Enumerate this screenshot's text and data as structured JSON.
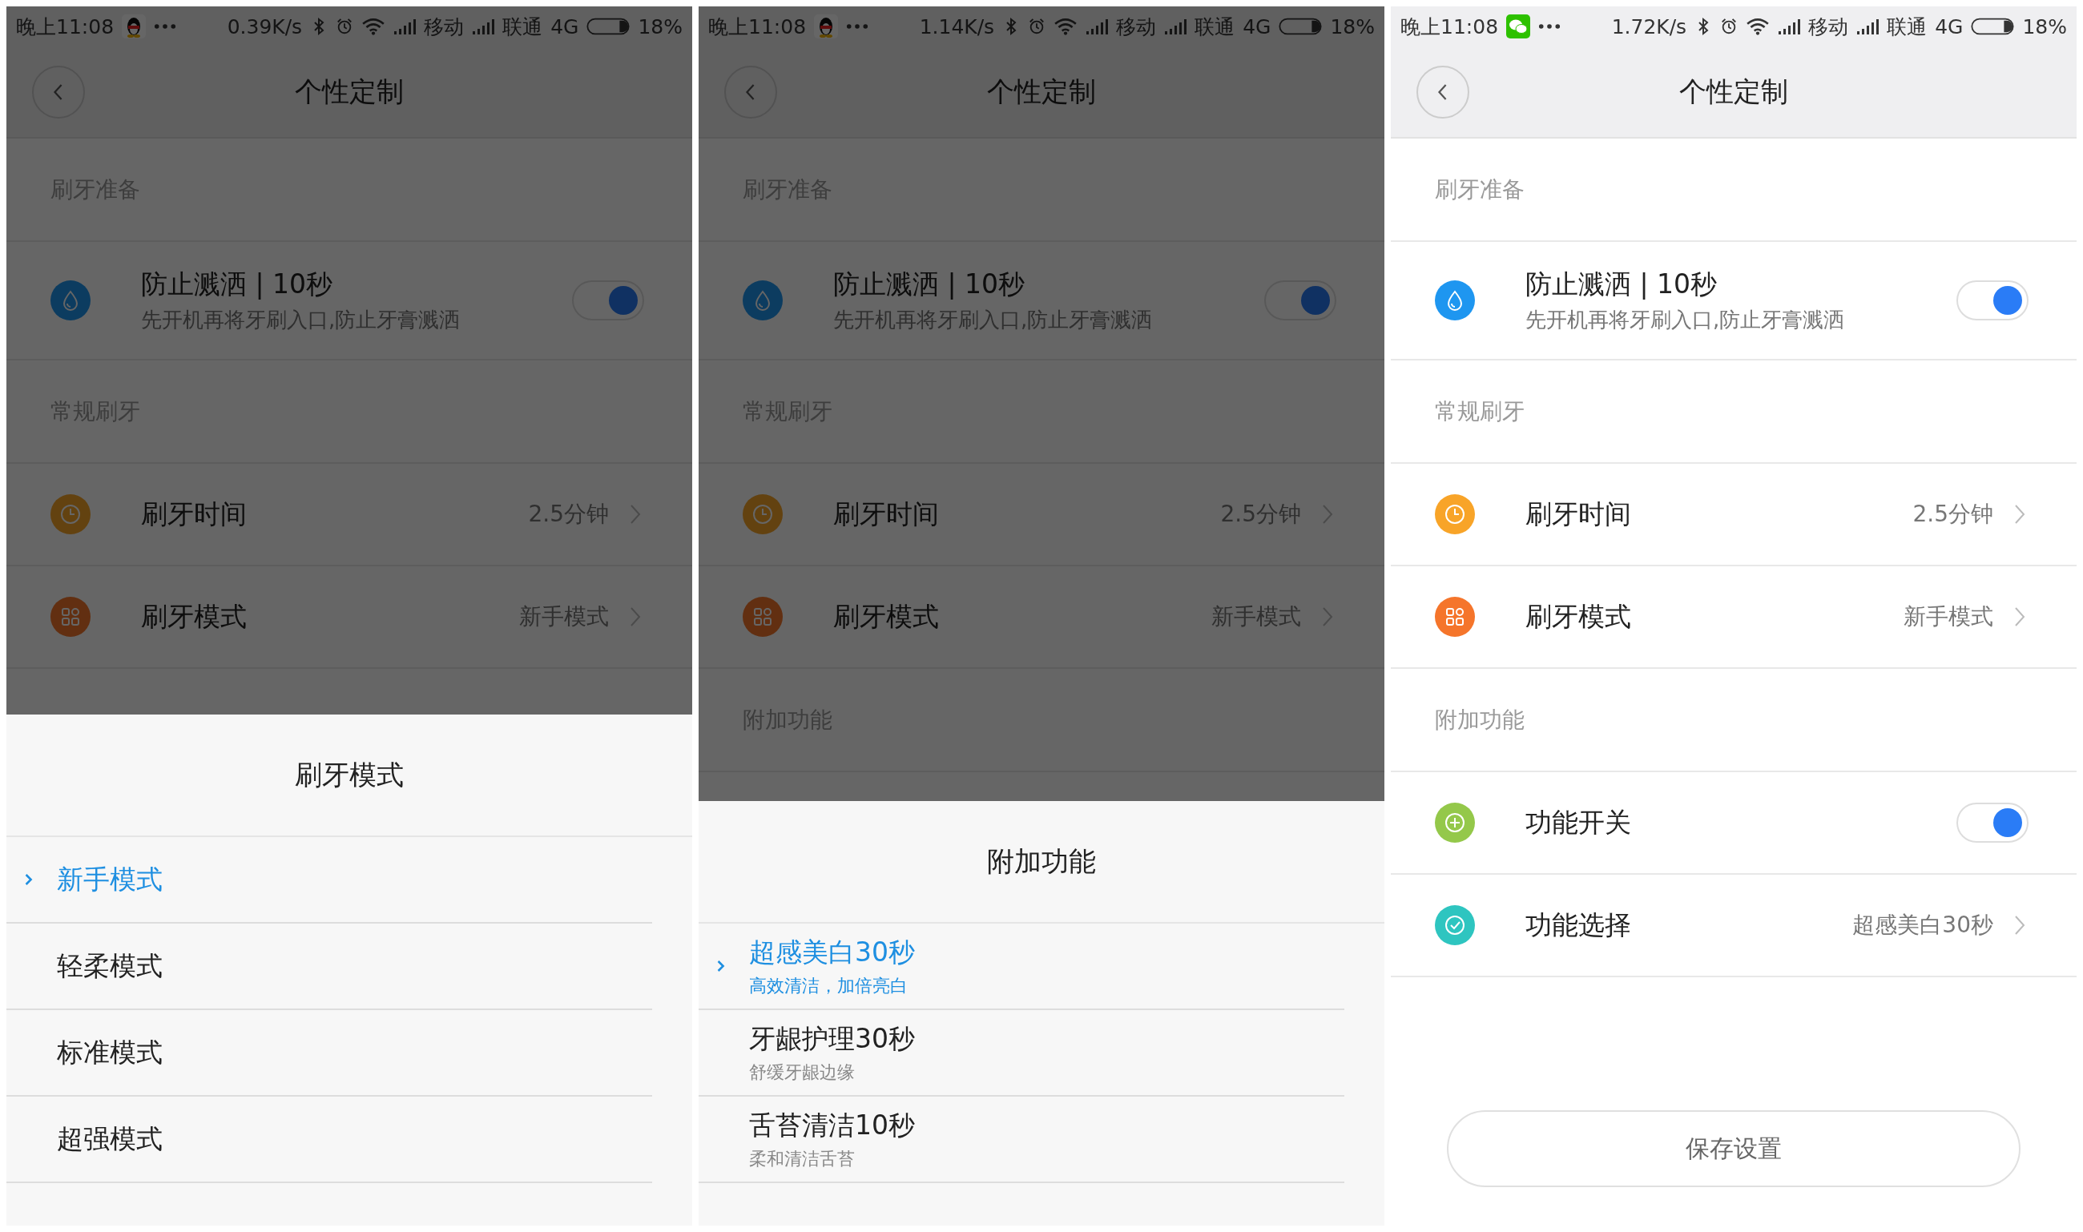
{
  "screens": [
    {
      "dimmed": true,
      "status_bar": {
        "time": "晚上11:08",
        "notification": {
          "kind": "penguin"
        },
        "speed": "0.39K/s",
        "carrier_1": "移动",
        "carrier_2": "联通",
        "network": "4G",
        "battery": "18%"
      },
      "header": {
        "title": "个性定制"
      },
      "sections": [
        {
          "title": "刷牙准备",
          "rows": [
            {
              "kind": "toggle",
              "color": "#0c3c60",
              "label": "防止溅洒 | 10秒",
              "subtitle": "先开机再将牙刷入口,防止牙膏溅洒",
              "on": true
            }
          ]
        },
        {
          "title": "常规刷牙",
          "rows": [
            {
              "kind": "value",
              "color": "#634210",
              "label": "刷牙时间",
              "value": "2.5分钟"
            },
            {
              "kind": "value",
              "color": "#622f11",
              "label": "刷牙模式",
              "value": "新手模式"
            }
          ]
        }
      ],
      "sheet": {
        "title": "刷牙模式",
        "options": [
          {
            "label": "新手模式",
            "selected": true
          },
          {
            "label": "轻柔模式",
            "selected": false
          },
          {
            "label": "标准模式",
            "selected": false
          },
          {
            "label": "超强模式",
            "selected": false
          }
        ]
      }
    },
    {
      "dimmed": true,
      "status_bar": {
        "time": "晚上11:08",
        "notification": {
          "kind": "penguin"
        },
        "speed": "1.14K/s",
        "carrier_1": "移动",
        "carrier_2": "联通",
        "network": "4G",
        "battery": "18%"
      },
      "header": {
        "title": "个性定制"
      },
      "sections": [
        {
          "title": "刷牙准备",
          "rows": [
            {
              "kind": "toggle",
              "color": "#0c3c60",
              "label": "防止溅洒 | 10秒",
              "subtitle": "先开机再将牙刷入口,防止牙膏溅洒",
              "on": true
            }
          ]
        },
        {
          "title": "常规刷牙",
          "rows": [
            {
              "kind": "value",
              "color": "#634210",
              "label": "刷牙时间",
              "value": "2.5分钟"
            },
            {
              "kind": "value",
              "color": "#622f11",
              "label": "刷牙模式",
              "value": "新手模式"
            }
          ]
        },
        {
          "title": "附加功能"
        }
      ],
      "sheet": {
        "title": "附加功能",
        "options": [
          {
            "label": "超感美白30秒",
            "subtitle": "高效清洁，加倍亮白",
            "selected": true
          },
          {
            "label": "牙龈护理30秒",
            "subtitle": "舒缓牙龈边缘",
            "selected": false
          },
          {
            "label": "舌苔清洁10秒",
            "subtitle": "柔和清洁舌苔",
            "selected": false
          }
        ]
      }
    },
    {
      "dimmed": false,
      "status_bar": {
        "time": "晚上11:08",
        "notification": {
          "kind": "chat"
        },
        "speed": "1.72K/s",
        "carrier_1": "移动",
        "carrier_2": "联通",
        "network": "4G",
        "battery": "18%"
      },
      "header": {
        "title": "个性定制"
      },
      "sections": [
        {
          "title": "刷牙准备",
          "rows": [
            {
              "kind": "toggle",
              "color": "#1e96f0",
              "label": "防止溅洒 | 10秒",
              "subtitle": "先开机再将牙刷入口,防止牙膏溅洒",
              "on": true
            }
          ]
        },
        {
          "title": "常规刷牙",
          "rows": [
            {
              "kind": "value",
              "color": "#f8a428",
              "label": "刷牙时间",
              "value": "2.5分钟"
            },
            {
              "kind": "value",
              "color": "#f5752b",
              "label": "刷牙模式",
              "value": "新手模式"
            }
          ]
        },
        {
          "title": "附加功能",
          "rows": [
            {
              "kind": "toggle",
              "color": "#94c84a",
              "label": "功能开关",
              "on": true
            },
            {
              "kind": "value",
              "color": "#2ec5c0",
              "label": "功能选择",
              "value": "超感美白30秒"
            }
          ]
        }
      ],
      "save_button": "保存设置"
    }
  ]
}
